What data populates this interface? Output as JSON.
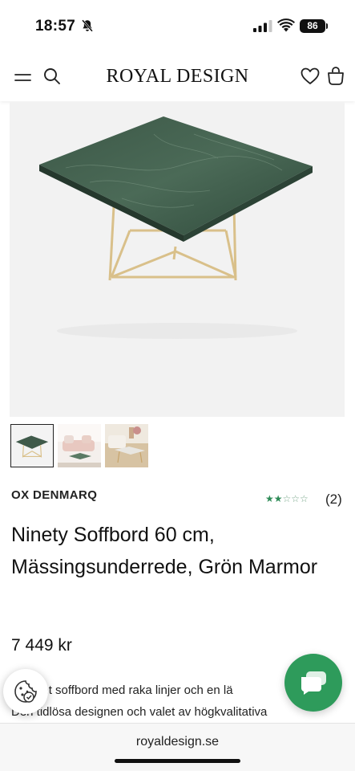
{
  "status_bar": {
    "time": "18:57",
    "battery": "86",
    "icons": [
      "bell-slash-icon",
      "signal-icon",
      "wifi-icon",
      "battery-icon"
    ]
  },
  "header": {
    "logo": "ROYAL DESIGN",
    "icons": [
      "menu-icon",
      "search-icon",
      "heart-icon",
      "shopping-bag-icon"
    ]
  },
  "product": {
    "brand": "OX DENMARQ",
    "rating": {
      "value": 2,
      "max": 5,
      "stars_on": "★★",
      "stars_off": "☆☆☆"
    },
    "review_count": "(2)",
    "title": "Ninety Soffbord 60 cm, Mässingsunderrede, Grön Marmor",
    "price": "7 449 kr",
    "description_line1": "Elegant soffbord med raka linjer och en lä",
    "description_line2": "Den tidlösa designen och valet av högkvalitativa",
    "thumbnails": [
      "thumbnail-1",
      "thumbnail-2",
      "thumbnail-3"
    ],
    "active_thumbnail": 1
  },
  "colors": {
    "accent_green": "#2e9b5b",
    "marble": "#3f5a4a",
    "brass": "#d9c08a"
  },
  "browser": {
    "url": "royaldesign.se"
  }
}
